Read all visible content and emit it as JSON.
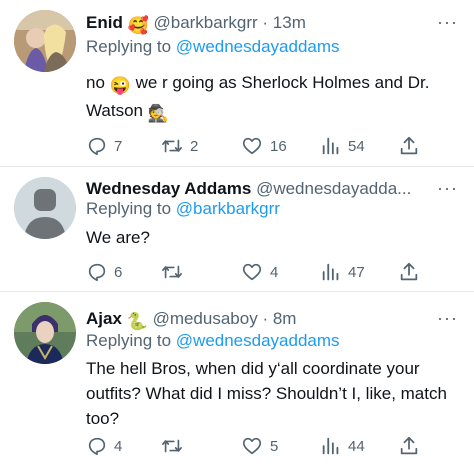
{
  "tweets": [
    {
      "name": "Enid",
      "name_emoji": "🥰",
      "handle": "@barkbarkgrr",
      "time": " · 13m",
      "replying_prefix": "Replying to ",
      "replying_to": "@wednesdayaddams",
      "text_a": "no",
      "text_a_emoji": "😜",
      "text_b": "we r going as Sherlock Holmes and Dr. Watson",
      "text_b_emoji": "🕵",
      "replies": "7",
      "retweets": "2",
      "likes": "16",
      "views": "54"
    },
    {
      "name": "Wednesday Addams",
      "handle": "@wednesdayadda...",
      "replying_prefix": "Replying to ",
      "replying_to": "@barkbarkgrr",
      "text": "We are?",
      "replies": "6",
      "retweets": "",
      "likes": "4",
      "views": "47"
    },
    {
      "name": "Ajax",
      "name_emoji": "🐍",
      "handle": "@medusaboy",
      "time": " · 8m",
      "replying_prefix": "Replying to ",
      "replying_to": "@wednesdayaddams",
      "text": "The hell Bros, when did y‘all coordinate your outfits? What did I miss? Shouldn’t I, like, match too?",
      "replies": "4",
      "retweets": "",
      "likes": "5",
      "views": "44"
    }
  ],
  "more_label": "···",
  "colors": {
    "link": "#1d9bf0",
    "muted": "#536471",
    "text": "#0f1419",
    "divider": "#e6e9ec"
  }
}
